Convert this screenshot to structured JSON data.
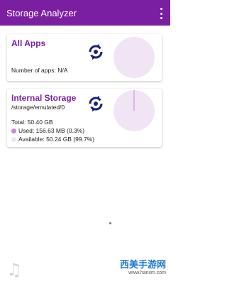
{
  "appbar": {
    "title": "Storage Analyzer",
    "background": "#7b1fa2",
    "overflow_icon": "overflow-menu-icon"
  },
  "all_apps": {
    "title": "All Apps",
    "apps_label": "Number of apps: N/A",
    "refresh_icon": "refresh-icon"
  },
  "internal": {
    "title": "Internal Storage",
    "path": "/storage/emulated/0",
    "total": "Total: 50.40 GB",
    "used": "Used: 156.63 MB (0.3%)",
    "available": "Available: 50.24 GB (99.7%)",
    "used_fraction": 0.003,
    "used_color": "#c987dc",
    "available_color": "#ece6ee",
    "refresh_icon": "refresh-icon"
  },
  "watermark": {
    "brand": "西美手游网",
    "url": "www.hanxm.com"
  }
}
